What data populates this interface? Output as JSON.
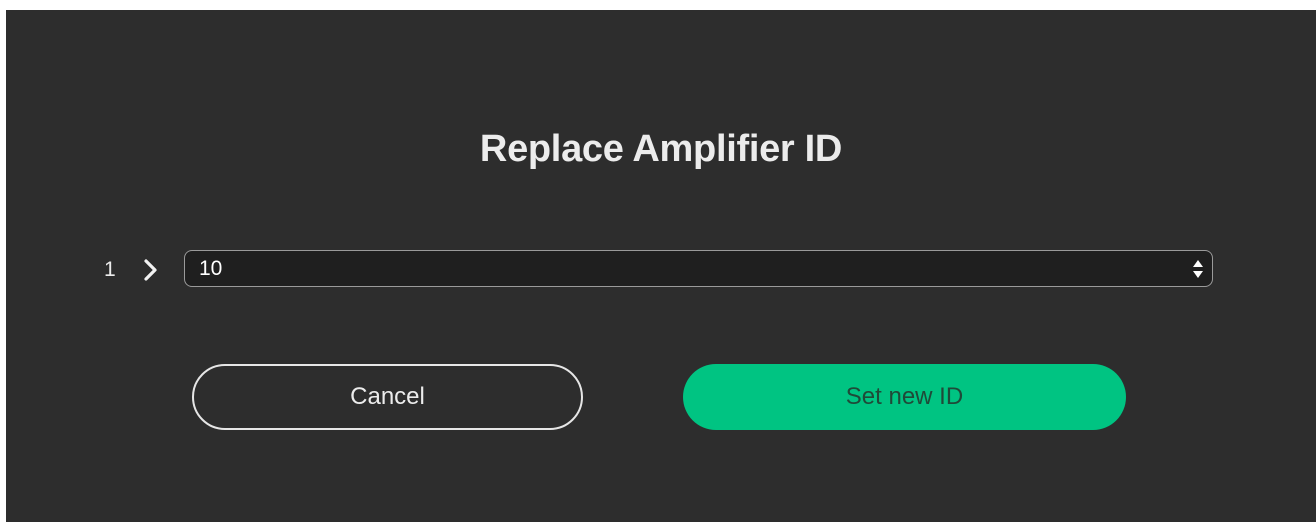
{
  "dialog": {
    "title": "Replace Amplifier ID",
    "row": {
      "index_label": "1",
      "chevron_icon": "chevron-right-icon",
      "select": {
        "value": "10",
        "stepper_icon": "up-down-stepper-icon"
      }
    },
    "buttons": {
      "cancel_label": "Cancel",
      "confirm_label": "Set new ID"
    },
    "colors": {
      "background": "#2d2d2d",
      "select_background": "#1f1f1f",
      "primary": "#00c482",
      "text": "#ececec"
    }
  }
}
